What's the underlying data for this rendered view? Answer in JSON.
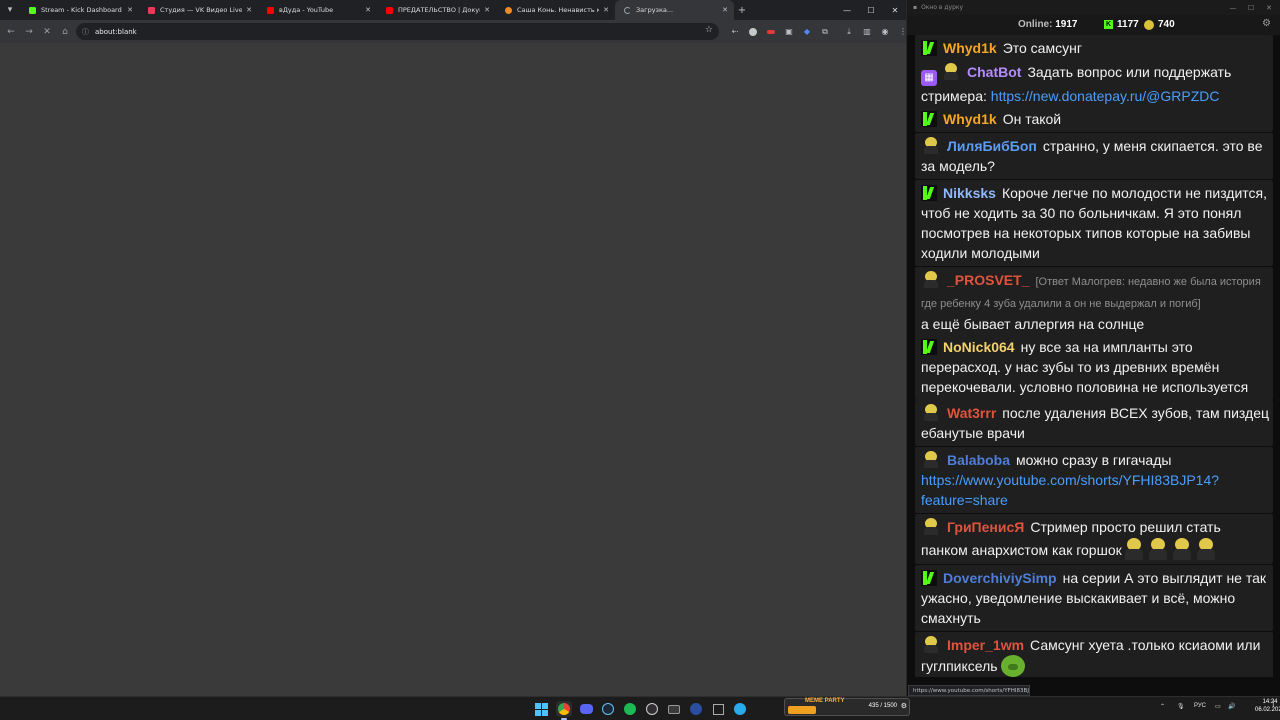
{
  "browser": {
    "tabs": [
      {
        "title": "Stream - Kick Dashboard",
        "favicon": "kick-favicon-icon",
        "color": "#53fc18"
      },
      {
        "title": "Студия — VK Видео Live",
        "favicon": "vk-video-favicon-icon",
        "color": "#e83b5c"
      },
      {
        "title": "вДуда - YouTube",
        "favicon": "youtube-favicon-icon",
        "color": "#ff0000"
      },
      {
        "title": "ПРЕДАТЕЛЬСТВО | Документальный",
        "favicon": "youtube-favicon-icon",
        "color": "#ff0000"
      },
      {
        "title": "Саша Конь. Ненависть к Стас",
        "favicon": "orange-favicon-icon",
        "color": "#f08a24"
      },
      {
        "title": "Загрузка...",
        "favicon": "loading-icon",
        "color": ""
      }
    ],
    "address": "about:blank"
  },
  "chat": {
    "window_title": "Окно в дурку",
    "online_label": "Online:",
    "online_count": "1917",
    "kick_count": "1177",
    "troll_count": "740",
    "messages": [
      {
        "badges": [
          "kick"
        ],
        "nick": "Whyd1k",
        "nick_color": "#f5a623",
        "text": "Это самсунг"
      },
      {
        "badges": [
          "bot",
          "troll"
        ],
        "nick": "ChatBot",
        "nick_color": "#b58cff",
        "text": "Задать вопрос или поддержать стримера: ",
        "link": "https://new.donatepay.ru/@GRPZDC"
      },
      {
        "badges": [
          "kick"
        ],
        "nick": "Whyd1k",
        "nick_color": "#f5a623",
        "text": "Он такой"
      },
      {
        "badges": [
          "troll"
        ],
        "nick": "ЛиляБибБоп",
        "nick_color": "#5b9cf5",
        "text": "странно, у меня скипается. это ве за модель?"
      },
      {
        "badges": [
          "kick"
        ],
        "nick": "Nikksks",
        "nick_color": "#8fb8ff",
        "text": "Короче легче по молодости не пиздится, чтоб не ходить за 30 по больничкам. Я это понял посмотрев на некоторых типов которые на забивы ходили молодыми"
      },
      {
        "badges": [
          "troll"
        ],
        "nick": "_PROSVET_",
        "nick_color": "#e0533d",
        "reply": "[Ответ Малогрев: недавно же была история где ребенку 4 зуба удалили а он не выдержал и погиб]",
        "text": "а ещё бывает аллергия на солнце"
      },
      {
        "badges": [
          "kick"
        ],
        "nick": "NoNick064",
        "nick_color": "#f3d36a",
        "text": "ну все за на импланты это перерасход. у нас зубы то из древних времён перекочевали. условно половина не используется"
      },
      {
        "badges": [
          "troll"
        ],
        "nick": "Wat3rrr",
        "nick_color": "#e0533d",
        "text": "после удаления ВСЕХ зубов, там пиздец ебанутые врачи"
      },
      {
        "badges": [
          "troll"
        ],
        "nick": "Balaboba",
        "nick_color": "#4f7ed8",
        "text": "можно сразу в гигачады ",
        "link": "https://www.youtube.com/shorts/YFHI83BJP14?feature=share"
      },
      {
        "badges": [
          "troll"
        ],
        "nick": "ГриПенисЯ",
        "nick_color": "#e0533d",
        "text": "Стример просто решил стать панком анархистом как горшок",
        "emotes": 4
      },
      {
        "badges": [
          "kick"
        ],
        "nick": "DoverchiviySimp",
        "nick_color": "#4f7ed8",
        "text": "на серии А это выглядит не так ужасно, уведомление выскакивает и всё, можно смахнуть"
      },
      {
        "badges": [
          "troll"
        ],
        "nick": "Imper_1wm",
        "nick_color": "#e0533d",
        "text": "Самсунг хуета .только ксиаоми или гуглпиксель ",
        "pig": true
      }
    ]
  },
  "status_url": "https://www.youtube.com/shorts/YFHI83BJ...",
  "taskbar": {
    "meme_label": "MEME PARTY",
    "meme_value": "435 / 1500",
    "tray_lang": "РУС",
    "time": "14:24",
    "date": "06.02.2026"
  }
}
